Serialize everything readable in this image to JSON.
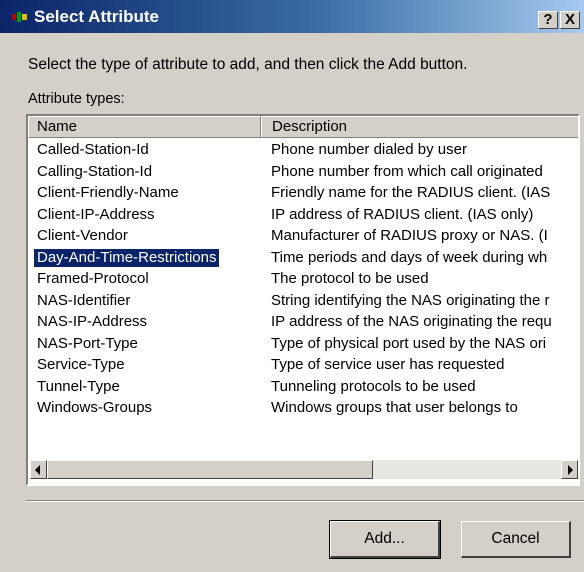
{
  "dialog": {
    "title": "Select Attribute",
    "help_button": "?",
    "close_button": "X",
    "instruction": "Select the type of attribute to add, and then click the Add button.",
    "list_label": "Attribute types:"
  },
  "table": {
    "columns": [
      "Name",
      "Description"
    ],
    "rows": [
      {
        "name": "Called-Station-Id",
        "description": "Phone number dialed by user"
      },
      {
        "name": "Calling-Station-Id",
        "description": "Phone number from which call originated"
      },
      {
        "name": "Client-Friendly-Name",
        "description": "Friendly name for the RADIUS client. (IAS"
      },
      {
        "name": "Client-IP-Address",
        "description": "IP address of RADIUS client. (IAS only)"
      },
      {
        "name": "Client-Vendor",
        "description": "Manufacturer of RADIUS proxy or NAS. (I"
      },
      {
        "name": "Day-And-Time-Restrictions",
        "description": "Time periods and days of week during wh"
      },
      {
        "name": "Framed-Protocol",
        "description": "The protocol to be used"
      },
      {
        "name": "NAS-Identifier",
        "description": "String identifying the NAS originating the r"
      },
      {
        "name": "NAS-IP-Address",
        "description": "IP address of the NAS originating the requ"
      },
      {
        "name": "NAS-Port-Type",
        "description": "Type of physical port used by the NAS ori"
      },
      {
        "name": "Service-Type",
        "description": "Type of service user has requested"
      },
      {
        "name": "Tunnel-Type",
        "description": "Tunneling protocols to be used"
      },
      {
        "name": "Windows-Groups",
        "description": "Windows groups that user belongs to"
      }
    ],
    "selected_index": 5
  },
  "buttons": {
    "add": "Add...",
    "cancel": "Cancel"
  },
  "colors": {
    "titlebar_start": "#0a246a",
    "titlebar_end": "#a6caf0",
    "selection": "#0a246a",
    "face": "#d4d0c8"
  }
}
